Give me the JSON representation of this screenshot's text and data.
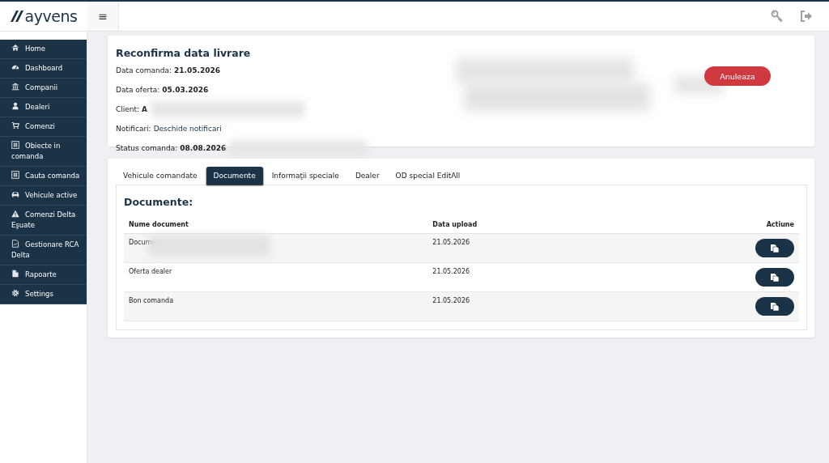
{
  "header": {
    "logo": "ayvens",
    "menu_toggle": "≡"
  },
  "sidebar": {
    "items": [
      {
        "label": "Home"
      },
      {
        "label": "Dashboard"
      },
      {
        "label": "Companii"
      },
      {
        "label": "Dealeri"
      },
      {
        "label": "Comenzi"
      },
      {
        "label": "Obiecte in comanda"
      },
      {
        "label": "Cauta comanda"
      },
      {
        "label": "Vehicule active"
      },
      {
        "label": "Comenzi Delta Eşuate"
      },
      {
        "label": "Gestionare RCA Delta"
      },
      {
        "label": "Rapoarte"
      },
      {
        "label": "Settings"
      }
    ]
  },
  "order_card": {
    "title": "Reconfirma data livrare",
    "fields": [
      {
        "kind": "bold",
        "label": "Data comanda:",
        "value": "21.05.2026"
      },
      {
        "kind": "bold",
        "label": "Data oferta:",
        "value": "05.03.2026"
      },
      {
        "kind": "bold",
        "label": "Client:",
        "value": "A"
      },
      {
        "kind": "link",
        "label": "Notificari:",
        "value": "Deschide notificari"
      },
      {
        "kind": "bold",
        "label": "Status comanda:",
        "value": "08.08.2026"
      }
    ],
    "cancel_button": "Anuleaza"
  },
  "tabs": [
    {
      "label": "Vehicule comandate",
      "selected": false
    },
    {
      "label": "Documente",
      "selected": true
    },
    {
      "label": "Informaţii speciale",
      "selected": false
    },
    {
      "label": "Dealer",
      "selected": false
    },
    {
      "label": "OD special EditAll",
      "selected": false
    }
  ],
  "documents": {
    "title": "Documente:",
    "columns": [
      "Nume document",
      "Data upload",
      "Actiune"
    ],
    "rows": [
      {
        "name": "Documer",
        "date": "21.05.2026"
      },
      {
        "name": "Oferta dealer",
        "date": "21.05.2026"
      },
      {
        "name": "Bon comanda",
        "date": "21.05.2026"
      }
    ]
  }
}
